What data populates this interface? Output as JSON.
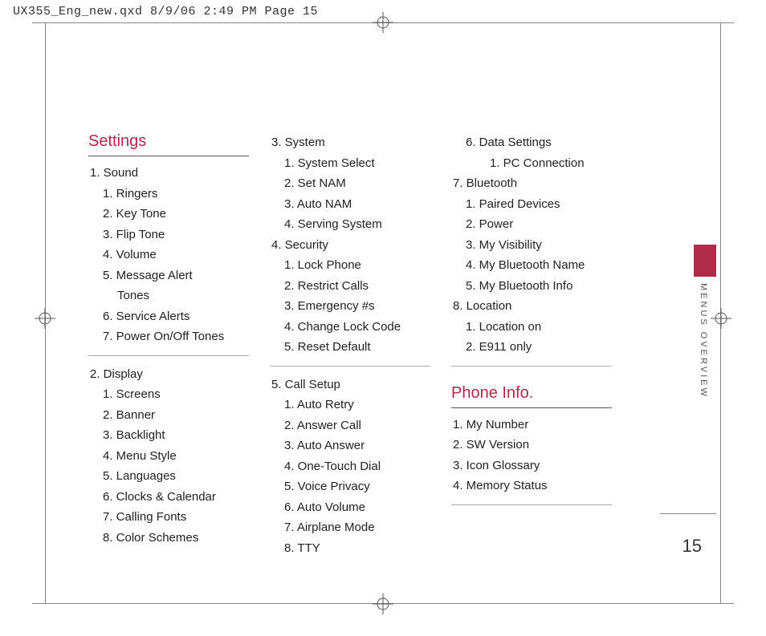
{
  "crop_header": "UX355_Eng_new.qxd  8/9/06  2:49 PM  Page 15",
  "side_label": "MENUS OVERVIEW",
  "page_number": "15",
  "sections": {
    "settings_title": "Settings",
    "phone_info_title": "Phone Info."
  },
  "col1": {
    "sound_head": "1. Sound",
    "sound": [
      "1. Ringers",
      "2. Key Tone",
      "3. Flip Tone",
      "4. Volume"
    ],
    "sound_msg_a": "5. Message Alert",
    "sound_msg_b": "Tones",
    "sound_tail": [
      "6. Service Alerts",
      "7.  Power On/Off Tones"
    ],
    "display_head": "2. Display",
    "display": [
      "1. Screens",
      "2. Banner",
      "3. Backlight",
      "4. Menu Style",
      "5. Languages",
      "6. Clocks & Calendar",
      "7.  Calling Fonts",
      "8. Color Schemes"
    ]
  },
  "col2": {
    "system_head": "3. System",
    "system": [
      "1. System Select",
      "2. Set NAM",
      "3. Auto NAM",
      "4. Serving System"
    ],
    "security_head": "4. Security",
    "security": [
      "1. Lock Phone",
      "2. Restrict Calls",
      "3. Emergency #s",
      "4. Change Lock Code",
      "5. Reset Default"
    ],
    "callsetup_head": "5. Call Setup",
    "callsetup": [
      "1. Auto Retry",
      "2. Answer Call",
      "3. Auto Answer",
      "4. One-Touch Dial",
      "5. Voice Privacy",
      "6. Auto Volume",
      "7.  Airplane Mode",
      "8. TTY"
    ]
  },
  "col3": {
    "data_head": "6. Data Settings",
    "data_sub": "1. PC Connection",
    "bt_head": "7. Bluetooth",
    "bt": [
      "1. Paired Devices",
      "2. Power",
      "3. My Visibility",
      "4. My Bluetooth Name",
      "5. My Bluetooth Info"
    ],
    "loc_head": "8. Location",
    "loc": [
      "1. Location on",
      "2. E911 only"
    ],
    "phone_info": [
      "1. My Number",
      "2. SW Version",
      "3. Icon Glossary",
      "4. Memory Status"
    ]
  }
}
